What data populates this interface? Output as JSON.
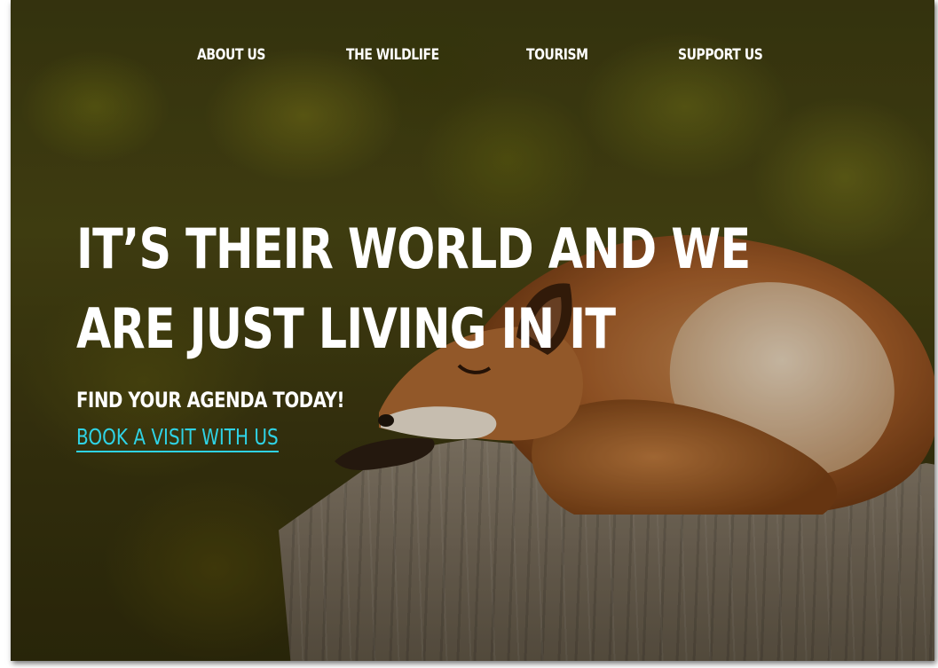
{
  "nav": {
    "items": [
      {
        "label": "ABOUT US"
      },
      {
        "label": "THE WILDLIFE"
      },
      {
        "label": "TOURISM"
      },
      {
        "label": "SUPPORT US"
      }
    ]
  },
  "hero": {
    "headline_line1": "IT’S THEIR WORLD AND WE",
    "headline_line2": "ARE JUST LIVING IN IT",
    "subheading": "FIND YOUR AGENDA TODAY!",
    "cta_label": "BOOK A VISIT WITH US"
  },
  "colors": {
    "text": "#ffffff",
    "link": "#2fd3e6"
  }
}
